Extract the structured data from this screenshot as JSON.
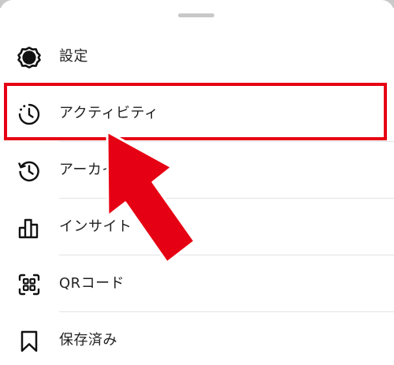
{
  "menu": {
    "items": [
      {
        "label": "設定",
        "icon": "gear-icon"
      },
      {
        "label": "アクティビティ",
        "icon": "activity-clock-icon"
      },
      {
        "label": "アーカイブ",
        "icon": "archive-history-icon"
      },
      {
        "label": "インサイト",
        "icon": "insights-bar-chart-icon"
      },
      {
        "label": "QRコード",
        "icon": "qr-code-icon"
      },
      {
        "label": "保存済み",
        "icon": "bookmark-icon"
      }
    ]
  },
  "annotation": {
    "highlight_color": "#e60013",
    "arrow_color": "#e60013",
    "target_item": "アクティビティ"
  }
}
